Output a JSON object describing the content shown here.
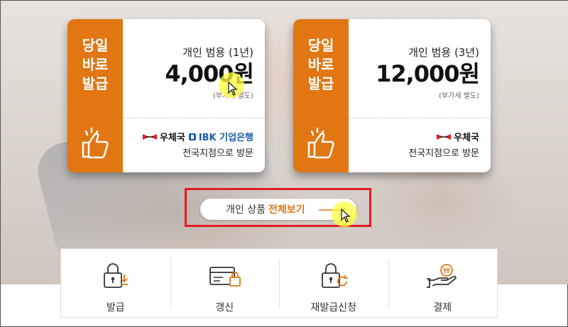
{
  "cards": [
    {
      "badge": [
        "당일",
        "바로",
        "발급"
      ],
      "product": "개인 범용 (1년)",
      "price": "4,000원",
      "vat_note": "(부가세 별도)",
      "issuers": [
        "우체국",
        "IBK 기업은행"
      ],
      "visit_note": "전국지점으로 방문"
    },
    {
      "badge": [
        "당일",
        "바로",
        "발급"
      ],
      "product": "개인 범용 (3년)",
      "price": "12,000원",
      "vat_note": "(부가세 별도)",
      "issuers": [
        "우체국"
      ],
      "visit_note": "전국지점으로 방문"
    }
  ],
  "view_all": {
    "label_prefix": "개인 상품",
    "label_bold": "전체보기"
  },
  "services": [
    {
      "label": "발급",
      "icon": "lock-download-icon"
    },
    {
      "label": "갱신",
      "icon": "card-lock-icon"
    },
    {
      "label": "재발급신청",
      "icon": "lock-refresh-icon"
    },
    {
      "label": "결제",
      "icon": "hand-coin-icon"
    }
  ],
  "colors": {
    "accent": "#e17613",
    "highlight_frame": "#e41b23",
    "ibk_blue": "#1b5aa8"
  }
}
